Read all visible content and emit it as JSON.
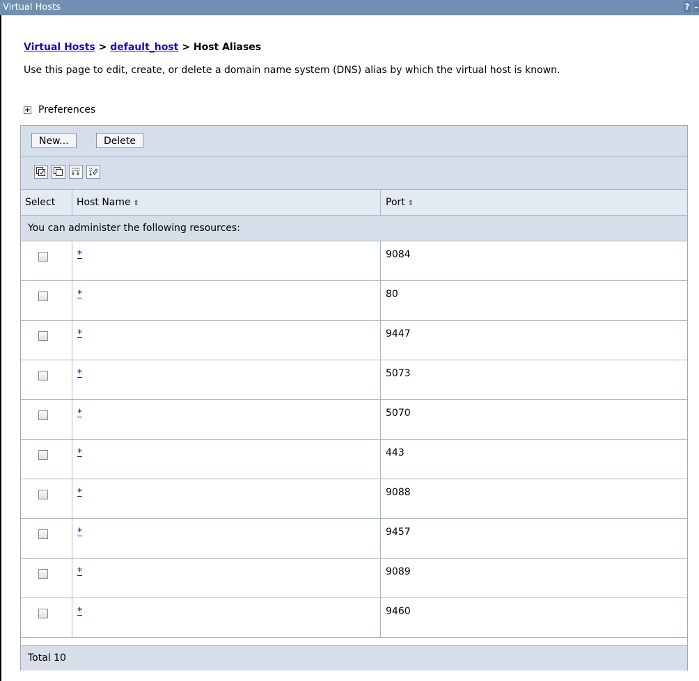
{
  "window": {
    "title": "Virtual Hosts",
    "help_label": "?",
    "minimize_label": "–"
  },
  "breadcrumb": {
    "item1": "Virtual Hosts",
    "sep1": " > ",
    "item2": "default_host",
    "sep2": " > ",
    "current": "Host Aliases"
  },
  "description": "Use this page to edit, create, or delete a domain name system (DNS) alias by which the virtual host is known.",
  "preferences": {
    "toggle": "+",
    "label": "Preferences"
  },
  "toolbar": {
    "new_label": "New...",
    "delete_label": "Delete"
  },
  "icons": [
    "select-all-icon",
    "deselect-all-icon",
    "show-filter-icon",
    "clear-filter-icon"
  ],
  "table": {
    "columns": {
      "select": "Select",
      "host": "Host Name",
      "port": "Port",
      "sort_glyph": "⇕"
    },
    "admin_message": "You can administer the following resources:",
    "rows": [
      {
        "host": "*",
        "port": "9084"
      },
      {
        "host": "*",
        "port": "80"
      },
      {
        "host": "*",
        "port": "9447"
      },
      {
        "host": "*",
        "port": "5073"
      },
      {
        "host": "*",
        "port": "5070"
      },
      {
        "host": "*",
        "port": "443"
      },
      {
        "host": "*",
        "port": "9088"
      },
      {
        "host": "*",
        "port": "9457"
      },
      {
        "host": "*",
        "port": "9089"
      },
      {
        "host": "*",
        "port": "9460"
      }
    ],
    "total": "Total 10"
  }
}
